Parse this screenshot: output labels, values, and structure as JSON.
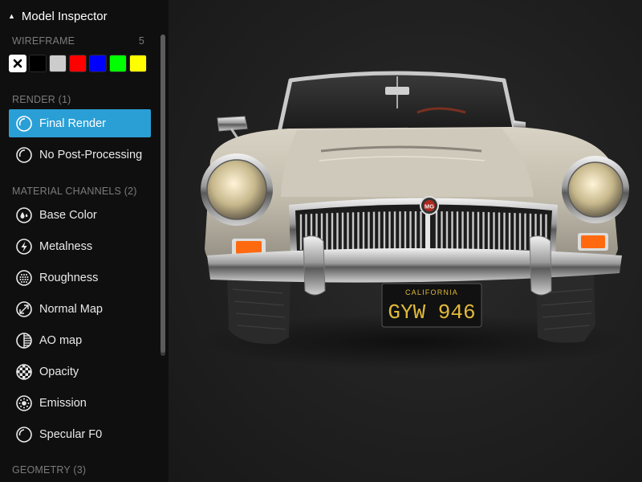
{
  "panel": {
    "title": "Model Inspector",
    "collapse_icon": "caret-up-icon"
  },
  "wireframe": {
    "title": "WIREFRAME",
    "value": "5",
    "swatches": [
      {
        "name": "none",
        "color": "#ffffff",
        "icon": "close-icon"
      },
      {
        "name": "black",
        "color": "#000000"
      },
      {
        "name": "light-gray",
        "color": "#cccccc"
      },
      {
        "name": "red",
        "color": "#ff0000"
      },
      {
        "name": "blue",
        "color": "#0000ff"
      },
      {
        "name": "green",
        "color": "#00ff00"
      },
      {
        "name": "yellow",
        "color": "#ffff00"
      }
    ]
  },
  "render": {
    "title": "RENDER (1)",
    "items": [
      {
        "label": "Final Render",
        "icon": "final-render-icon",
        "active": true
      },
      {
        "label": "No Post-Processing",
        "icon": "no-post-processing-icon",
        "active": false
      }
    ]
  },
  "material_channels": {
    "title": "MATERIAL CHANNELS (2)",
    "items": [
      {
        "label": "Base Color",
        "icon": "base-color-icon"
      },
      {
        "label": "Metalness",
        "icon": "metalness-icon"
      },
      {
        "label": "Roughness",
        "icon": "roughness-icon"
      },
      {
        "label": "Normal Map",
        "icon": "normal-map-icon"
      },
      {
        "label": "AO map",
        "icon": "ao-map-icon"
      },
      {
        "label": "Opacity",
        "icon": "opacity-icon"
      },
      {
        "label": "Emission",
        "icon": "emission-icon"
      },
      {
        "label": "Specular F0",
        "icon": "specular-f0-icon"
      }
    ]
  },
  "geometry": {
    "title": "GEOMETRY (3)"
  },
  "viewport": {
    "plate_state": "CALIFORNIA",
    "plate_number": "GYW 946",
    "badge": "MG"
  },
  "colors": {
    "sidebar_bg": "#0f0f0f",
    "active_item": "#2a9fd6",
    "section_title": "#7b7b7b",
    "viewport_bg": "#222222"
  }
}
